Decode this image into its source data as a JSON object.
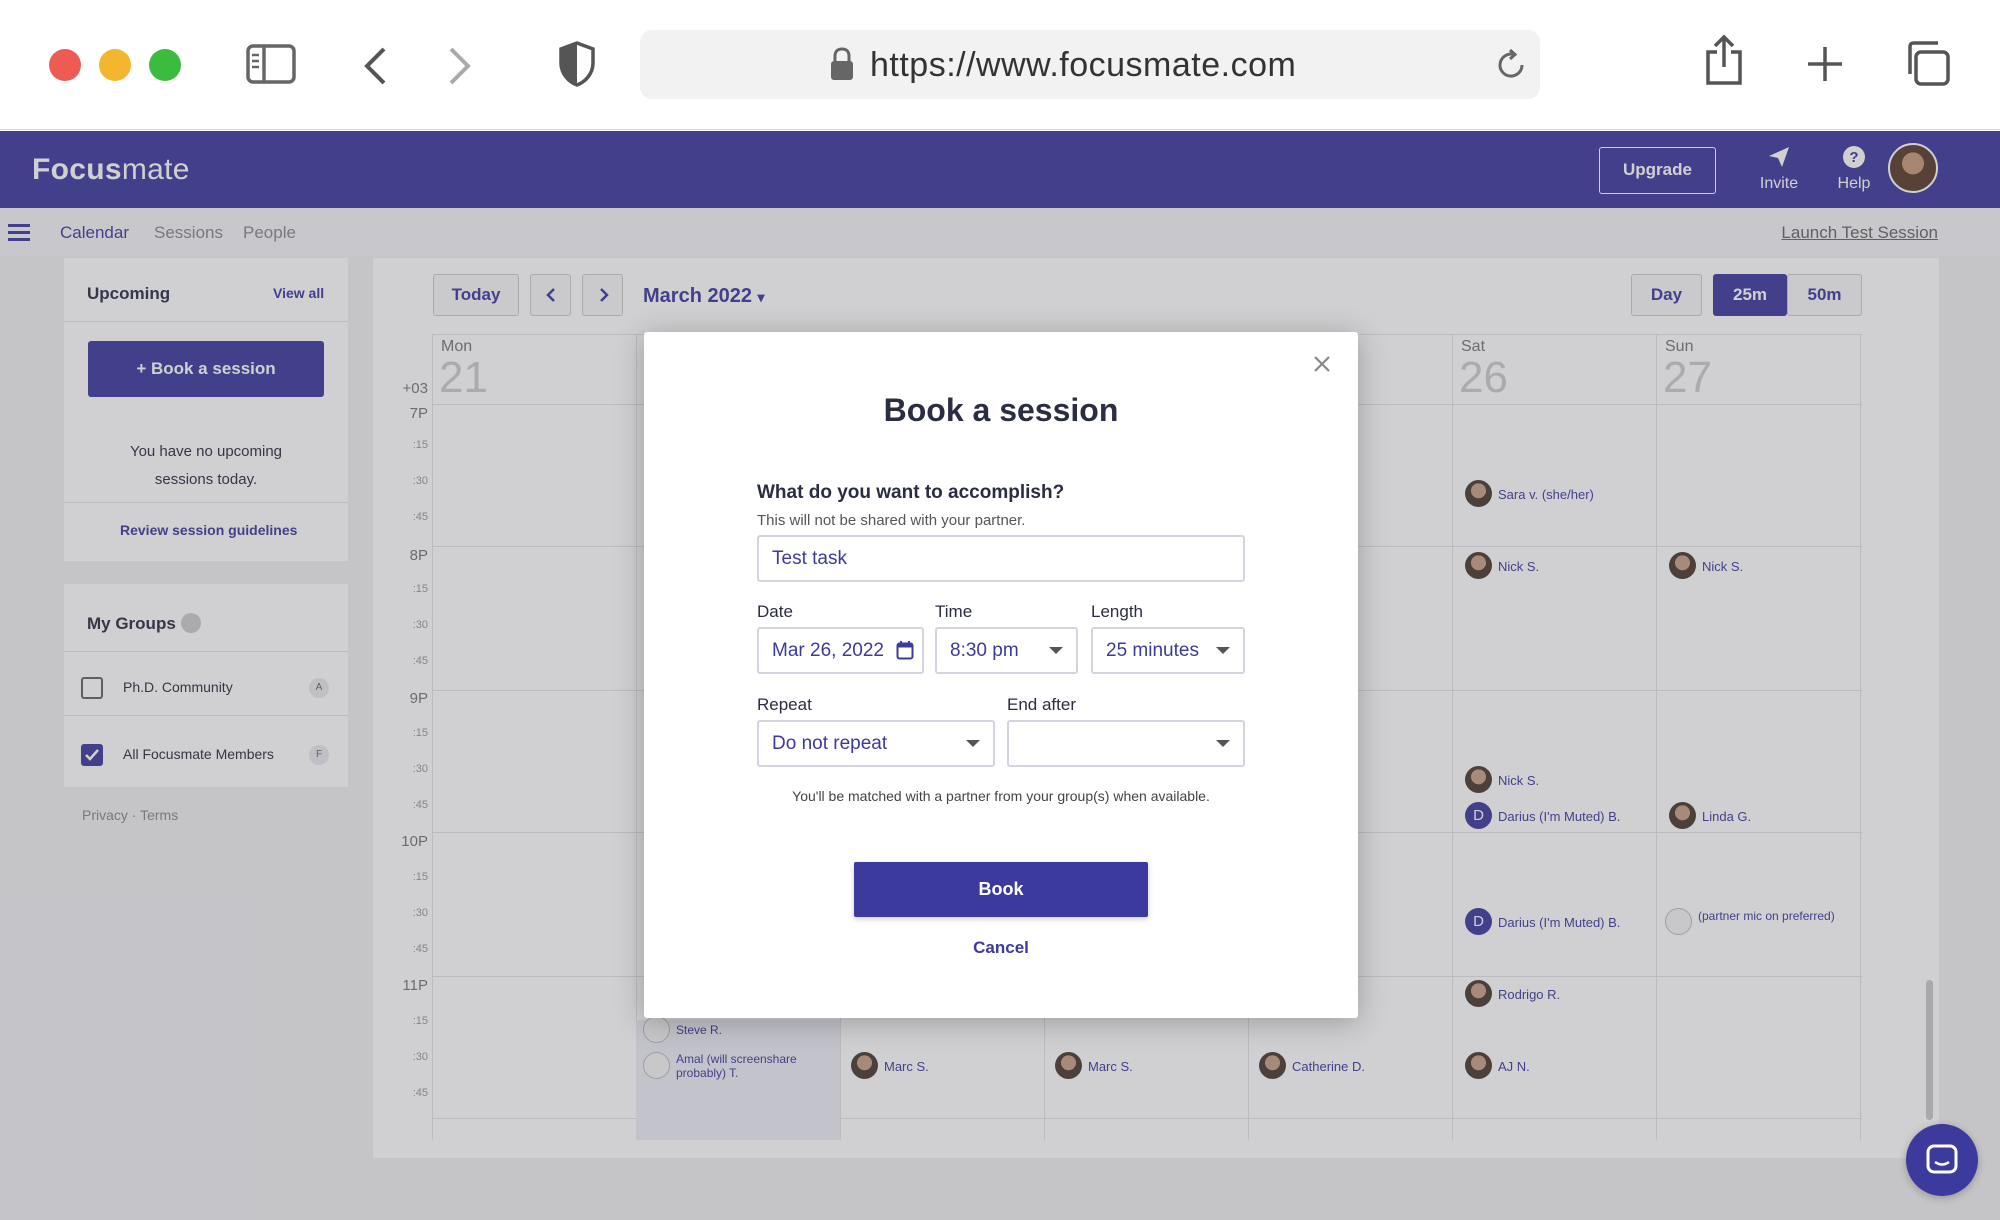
{
  "browser": {
    "url": "https://www.focusmate.com"
  },
  "header": {
    "logo_bold": "Focus",
    "logo_light": "mate",
    "upgrade": "Upgrade",
    "invite": "Invite",
    "help": "Help"
  },
  "nav": {
    "calendar": "Calendar",
    "sessions": "Sessions",
    "people": "People",
    "launch": "Launch Test Session"
  },
  "sidebar": {
    "upcoming": "Upcoming",
    "view_all": "View all",
    "book_button": "+ Book a session",
    "no_sessions_1": "You have no upcoming",
    "no_sessions_2": "sessions today.",
    "guidelines": "Review session guidelines",
    "groups_title": "My Groups",
    "groups": [
      {
        "name": "Ph.D. Community",
        "checked": false,
        "badge": "A"
      },
      {
        "name": "All Focusmate Members",
        "checked": true,
        "badge": "F"
      }
    ],
    "footer": "Privacy · Terms"
  },
  "calendar": {
    "today": "Today",
    "month": "March 2022",
    "view_day": "Day",
    "view_25": "25m",
    "view_50": "50m",
    "timezone": "+03",
    "days": [
      {
        "name": "Mon",
        "num": "21"
      },
      {
        "name": "Sat",
        "num": "26"
      },
      {
        "name": "Sun",
        "num": "27"
      }
    ],
    "times": [
      "7P",
      ":15",
      ":30",
      ":45",
      "8P",
      ":15",
      ":30",
      ":45",
      "9P",
      ":15",
      ":30",
      ":45",
      "10P",
      ":15",
      ":30",
      ":45",
      "11P",
      ":15",
      ":30",
      ":45"
    ],
    "events": {
      "sara": "Sara v. (she/her)",
      "nick": "Nick S.",
      "darius": "Darius (I'm Muted) B.",
      "linda": "Linda G.",
      "partner_mic": "(partner mic on preferred)",
      "rodrigo": "Rodrigo R.",
      "steve": "Steve R.",
      "amal_1": "Amal (will screenshare",
      "amal_2": "probably) T.",
      "marc": "Marc S.",
      "catherine": "Catherine D.",
      "aj": "AJ N.",
      "letter_d": "D"
    }
  },
  "modal": {
    "title": "Book a session",
    "question": "What do you want to accomplish?",
    "question_sub": "This will not be shared with your partner.",
    "task_value": "Test task",
    "date_label": "Date",
    "date_value": "Mar 26, 2022",
    "time_label": "Time",
    "time_value": "8:30 pm",
    "length_label": "Length",
    "length_value": "25 minutes",
    "repeat_label": "Repeat",
    "repeat_value": "Do not repeat",
    "end_label": "End after",
    "end_value": "",
    "note": "You'll be matched with a partner from your group(s) when available.",
    "book": "Book",
    "cancel": "Cancel"
  }
}
